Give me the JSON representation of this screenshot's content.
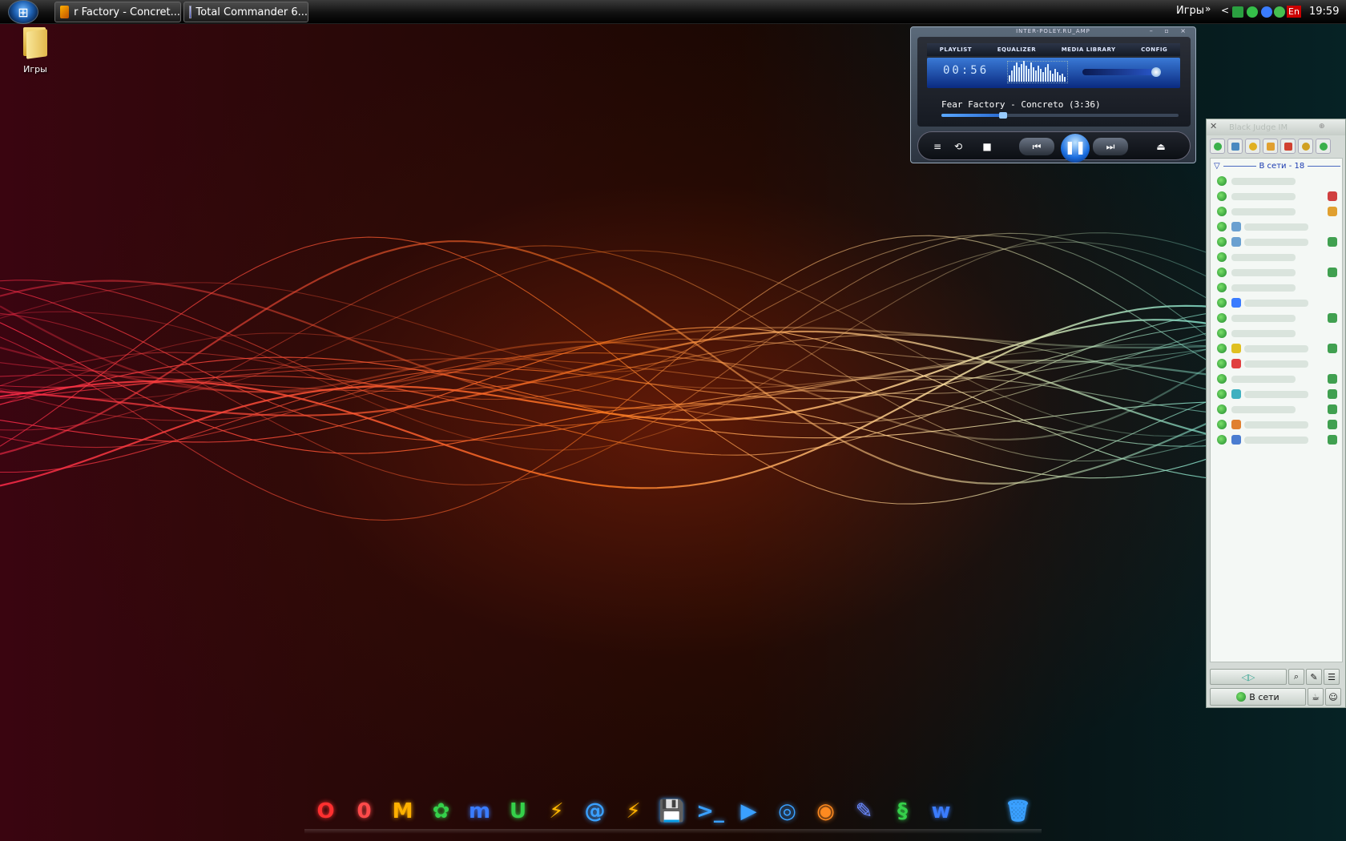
{
  "taskbar": {
    "tasks": [
      {
        "label": "r Factory - Concret...",
        "icon": "winamp-icon"
      },
      {
        "label": "Total Commander 6...",
        "icon": "total-commander-icon"
      }
    ],
    "toolbar_label": "Игры",
    "expand_glyph": "»",
    "collapse_glyph": "<",
    "language": "En",
    "clock": "19:59"
  },
  "desktop": {
    "icons": [
      {
        "label": "Игры",
        "icon": "folder-icon"
      }
    ]
  },
  "player": {
    "title": "INTER-POLEY.RU_AMP",
    "tabs": [
      "PLAYLIST",
      "EQUALIZER",
      "MEDIA LIBRARY",
      "CONFIG"
    ],
    "time": "00:56",
    "track": "Fear Factory - Concreto (3:36)",
    "progress": 0.26,
    "controls": {
      "eq": "≡",
      "repeat": "⟲",
      "stop": "■",
      "prev": "⏮",
      "pause": "❚❚",
      "next": "⏭",
      "open": "⏏"
    }
  },
  "im": {
    "title": "Black Judge IM",
    "group_label": "В сети - 18",
    "contact_count": 18,
    "status_label": "В сети",
    "nav_arrows": "◁▷"
  },
  "dock": {
    "items": [
      {
        "name": "opera-icon",
        "glyph": "O",
        "color": "#ff3030"
      },
      {
        "name": "qip-icon",
        "glyph": "0",
        "color": "#ff4a4a"
      },
      {
        "name": "miranda-icon",
        "glyph": "M",
        "color": "#ffb000"
      },
      {
        "name": "icq-icon",
        "glyph": "✿",
        "color": "#35d04a"
      },
      {
        "name": "mirc-icon",
        "glyph": "m",
        "color": "#3a7cff"
      },
      {
        "name": "utorrent-icon",
        "glyph": "U",
        "color": "#35d04a"
      },
      {
        "name": "winamp-icon",
        "glyph": "⚡",
        "color": "#ffb800"
      },
      {
        "name": "mail-icon",
        "glyph": "@",
        "color": "#3aa0ff"
      },
      {
        "name": "flashget-icon",
        "glyph": "⚡",
        "color": "#ffb000"
      },
      {
        "name": "floppy-icon",
        "glyph": "💾",
        "color": "#3aa0ff"
      },
      {
        "name": "terminal-icon",
        "glyph": ">_",
        "color": "#3aa0ff"
      },
      {
        "name": "media-player-icon",
        "glyph": "▶",
        "color": "#3aa0ff"
      },
      {
        "name": "network-icon",
        "glyph": "◎",
        "color": "#3aa0ff"
      },
      {
        "name": "nero-icon",
        "glyph": "◉",
        "color": "#ff8a20"
      },
      {
        "name": "paint-icon",
        "glyph": "✎",
        "color": "#6a8aff"
      },
      {
        "name": "games-icon",
        "glyph": "§",
        "color": "#35d04a"
      },
      {
        "name": "word-icon",
        "glyph": "w",
        "color": "#3a7cff"
      },
      {
        "name": "apple-icon",
        "glyph": "",
        "color": "#3aa0ff"
      },
      {
        "name": "trash-icon",
        "glyph": "🗑",
        "color": "#3aa0ff"
      }
    ]
  }
}
